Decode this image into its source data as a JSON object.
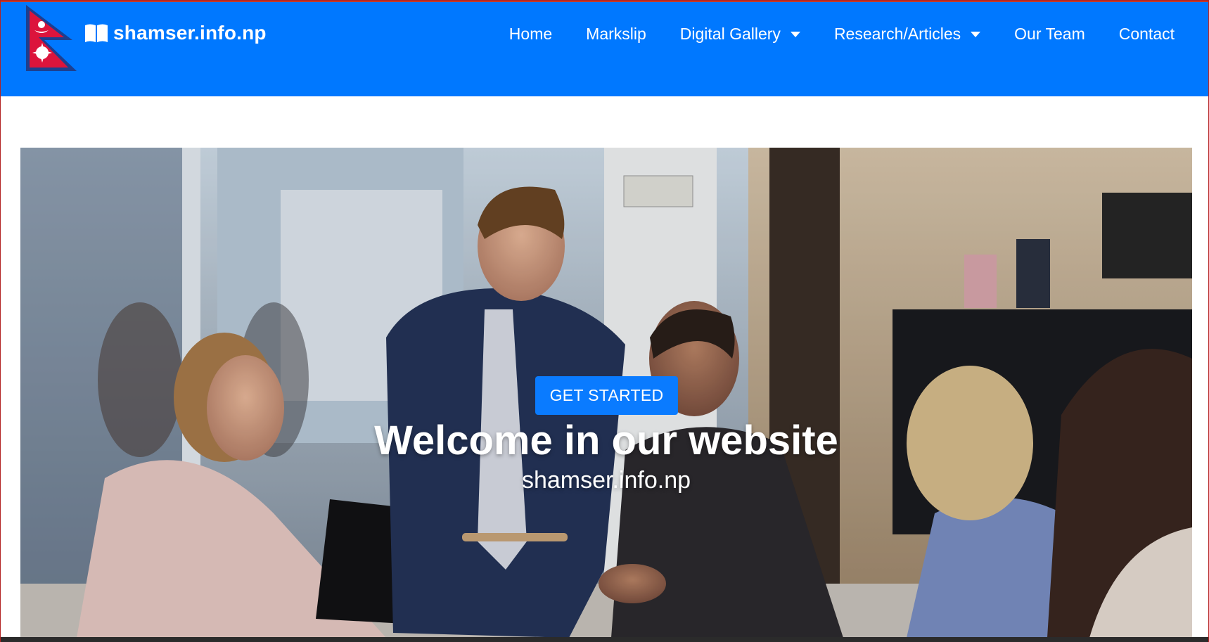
{
  "site": {
    "brand": "shamser.info.np"
  },
  "nav": {
    "items": [
      {
        "label": "Home",
        "dropdown": false
      },
      {
        "label": "Markslip",
        "dropdown": false
      },
      {
        "label": "Digital Gallery",
        "dropdown": true
      },
      {
        "label": "Research/Articles",
        "dropdown": true
      },
      {
        "label": "Our Team",
        "dropdown": false
      },
      {
        "label": "Contact",
        "dropdown": false
      }
    ]
  },
  "hero": {
    "button_label": "GET STARTED",
    "title": "Welcome in our website",
    "subtitle": "shamser.info.np",
    "image_description_icon": "office-team-photo"
  },
  "colors": {
    "navbar": "#0078ff",
    "button": "#0a7bff",
    "flag_red": "#dc143c",
    "flag_border": "#003893"
  }
}
